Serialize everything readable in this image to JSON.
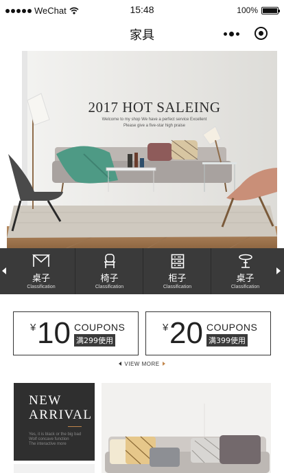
{
  "status_bar": {
    "carrier": "WeChat",
    "time": "15:48",
    "battery": "100%"
  },
  "nav": {
    "title": "家具"
  },
  "hero": {
    "title": "2017 HOT SALEING",
    "subtitle_line1": "Welcome to my shop We have a perfect service Excellent",
    "subtitle_line2": "Please give a five-star high praise"
  },
  "categories": [
    {
      "label": "桌子",
      "sub": "Classification",
      "icon": "table-icon"
    },
    {
      "label": "椅子",
      "sub": "Classification",
      "icon": "chair-icon"
    },
    {
      "label": "柜子",
      "sub": "Classification",
      "icon": "cabinet-icon"
    },
    {
      "label": "桌子",
      "sub": "Classification",
      "icon": "round-table-icon"
    }
  ],
  "coupons": [
    {
      "currency": "¥",
      "amount": "10",
      "title": "COUPONS",
      "condition": "满299使用"
    },
    {
      "currency": "¥",
      "amount": "20",
      "title": "COUPONS",
      "condition": "满399使用"
    }
  ],
  "view_more": "VIEW MORE",
  "arrival": {
    "line1": "NEW",
    "line2": "ARRIVAL",
    "desc1": "Yes, it is black or the big bad",
    "desc2": "Wolf  concave function",
    "desc3": "The interactive  more"
  },
  "colors": {
    "dark": "#3a3a3a",
    "accent": "#c2864c"
  }
}
